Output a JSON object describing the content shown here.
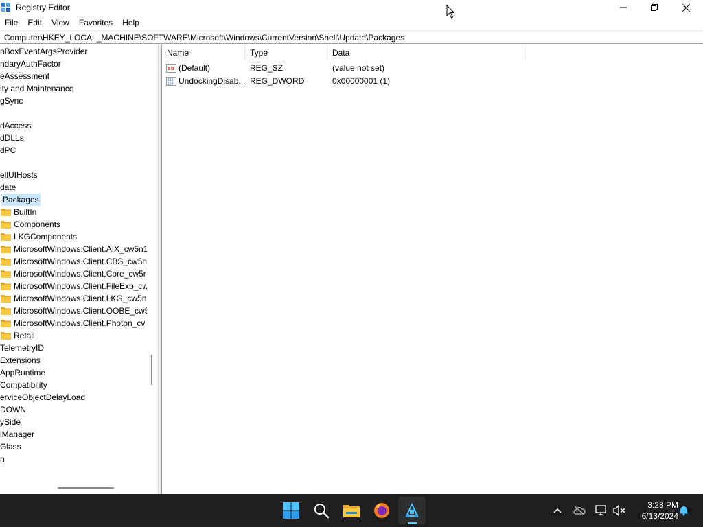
{
  "window": {
    "title": "Registry Editor"
  },
  "menu": [
    "File",
    "Edit",
    "View",
    "Favorites",
    "Help"
  ],
  "address": "Computer\\HKEY_LOCAL_MACHINE\\SOFTWARE\\Microsoft\\Windows\\CurrentVersion\\Shell\\Update\\Packages",
  "tree": {
    "items": [
      {
        "label": "nBoxEventArgsProvider",
        "folder": false,
        "selected": false
      },
      {
        "label": "ndaryAuthFactor",
        "folder": false,
        "selected": false
      },
      {
        "label": "eAssessment",
        "folder": false,
        "selected": false
      },
      {
        "label": "ity and Maintenance",
        "folder": false,
        "selected": false
      },
      {
        "label": "gSync",
        "folder": false,
        "selected": false
      },
      {
        "label": "",
        "folder": false,
        "selected": false
      },
      {
        "label": "dAccess",
        "folder": false,
        "selected": false
      },
      {
        "label": "dDLLs",
        "folder": false,
        "selected": false
      },
      {
        "label": "dPC",
        "folder": false,
        "selected": false
      },
      {
        "label": "",
        "folder": false,
        "selected": false
      },
      {
        "label": "ellUIHosts",
        "folder": false,
        "selected": false
      },
      {
        "label": "date",
        "folder": false,
        "selected": false
      },
      {
        "label": "Packages",
        "folder": false,
        "selected": true
      },
      {
        "label": "BuiltIn",
        "folder": true,
        "selected": false
      },
      {
        "label": "Components",
        "folder": true,
        "selected": false
      },
      {
        "label": "LKGComponents",
        "folder": true,
        "selected": false
      },
      {
        "label": "MicrosoftWindows.Client.AIX_cw5n1",
        "folder": true,
        "selected": false
      },
      {
        "label": "MicrosoftWindows.Client.CBS_cw5n",
        "folder": true,
        "selected": false
      },
      {
        "label": "MicrosoftWindows.Client.Core_cw5r",
        "folder": true,
        "selected": false
      },
      {
        "label": "MicrosoftWindows.Client.FileExp_cw",
        "folder": true,
        "selected": false
      },
      {
        "label": "MicrosoftWindows.Client.LKG_cw5n",
        "folder": true,
        "selected": false
      },
      {
        "label": "MicrosoftWindows.Client.OOBE_cw5",
        "folder": true,
        "selected": false
      },
      {
        "label": "MicrosoftWindows.Client.Photon_cv",
        "folder": true,
        "selected": false
      },
      {
        "label": "Retail",
        "folder": true,
        "selected": false
      },
      {
        "label": "TelemetryID",
        "folder": false,
        "selected": false
      },
      {
        "label": "Extensions",
        "folder": false,
        "selected": false
      },
      {
        "label": "AppRuntime",
        "folder": false,
        "selected": false
      },
      {
        "label": "Compatibility",
        "folder": false,
        "selected": false
      },
      {
        "label": "erviceObjectDelayLoad",
        "folder": false,
        "selected": false
      },
      {
        "label": "DOWN",
        "folder": false,
        "selected": false
      },
      {
        "label": "ySide",
        "folder": false,
        "selected": false
      },
      {
        "label": "lManager",
        "folder": false,
        "selected": false
      },
      {
        "label": "Glass",
        "folder": false,
        "selected": false
      },
      {
        "label": "n",
        "folder": false,
        "selected": false
      }
    ]
  },
  "list": {
    "columns": [
      "Name",
      "Type",
      "Data"
    ],
    "rows": [
      {
        "name": "(Default)",
        "type": "REG_SZ",
        "data": "(value not set)",
        "icon": "string-value-icon"
      },
      {
        "name": "UndockingDisab...",
        "type": "REG_DWORD",
        "data": "0x00000001 (1)",
        "icon": "binary-value-icon"
      }
    ]
  },
  "taskbar": {
    "apps": [
      "start-icon",
      "search-icon",
      "file-explorer-icon",
      "firefox-icon",
      "registry-editor-icon"
    ],
    "time": "3:28 PM",
    "date": "6/13/2024"
  },
  "colors": {
    "selection": "#cce8ff",
    "folder": "#f8c843",
    "taskbar": "#1f1f1f",
    "accent": "#60cdff"
  }
}
